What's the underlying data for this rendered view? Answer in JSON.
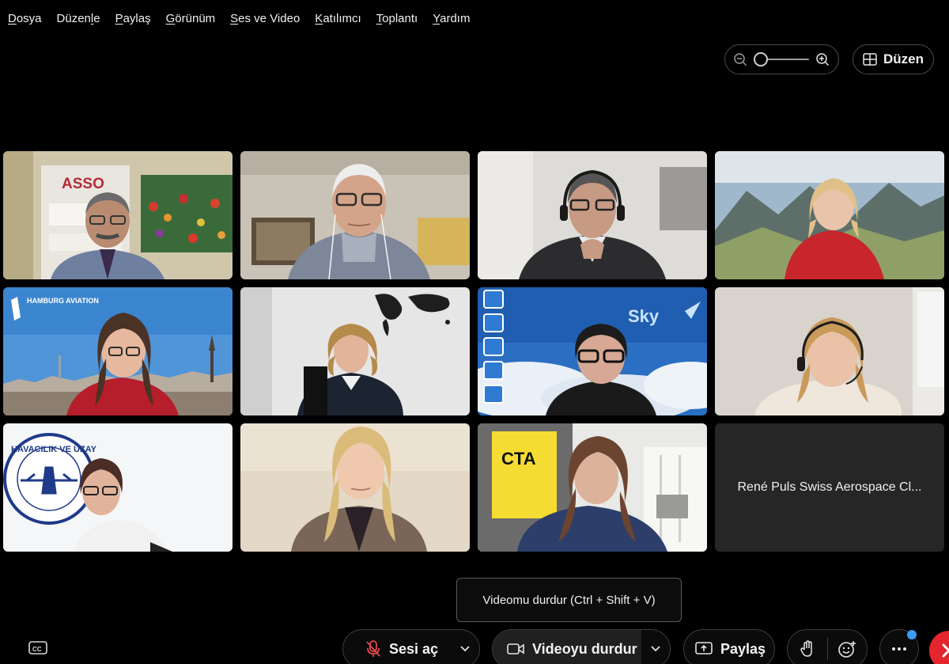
{
  "menu": [
    {
      "label": "Dosya",
      "shortcut_index": 0
    },
    {
      "label": "Düzenle",
      "shortcut_index": 5
    },
    {
      "label": "Paylaş",
      "shortcut_index": 0
    },
    {
      "label": "Görünüm",
      "shortcut_index": 0
    },
    {
      "label": "Ses ve Video",
      "shortcut_index": 0
    },
    {
      "label": "Katılımcı",
      "shortcut_index": 0
    },
    {
      "label": "Toplantı",
      "shortcut_index": 0
    },
    {
      "label": "Yardım",
      "shortcut_index": 0
    }
  ],
  "toolbar": {
    "zoom_level": 0,
    "layout_label": "Düzen"
  },
  "tiles": [
    {
      "kind": "video",
      "scene": "office-poster",
      "signage": "ASSO"
    },
    {
      "kind": "video",
      "scene": "elderly-man"
    },
    {
      "kind": "video",
      "scene": "man-headset"
    },
    {
      "kind": "video",
      "scene": "woman-mountains"
    },
    {
      "kind": "video",
      "scene": "hamburg-backdrop",
      "signage": "HAMBURG AVIATION"
    },
    {
      "kind": "video",
      "scene": "woman-map-wall"
    },
    {
      "kind": "video",
      "scene": "sky-backdrop",
      "signage": "Sky"
    },
    {
      "kind": "video",
      "scene": "woman-office"
    },
    {
      "kind": "video",
      "scene": "cluster-logo",
      "signage": "HAVACILIK VE UZAY"
    },
    {
      "kind": "video",
      "scene": "woman-blazer"
    },
    {
      "kind": "video",
      "scene": "cta-office",
      "signage": "CTA"
    },
    {
      "kind": "name",
      "name": "René Puls Swiss Aerospace Cl..."
    }
  ],
  "tooltip": "Videomu durdur (Ctrl + Shift + V)",
  "controls": {
    "mute_label": "Sesi aç",
    "video_label": "Videoyu durdur",
    "share_label": "Paylaş"
  },
  "icons": [
    "zoom-out-icon",
    "zoom-in-icon",
    "grid-layout-icon",
    "closed-caption-icon",
    "microphone-muted-icon",
    "camera-icon",
    "share-screen-icon",
    "raise-hand-icon",
    "reactions-icon",
    "more-icon",
    "end-call-icon"
  ],
  "colors": {
    "background": "#000000",
    "tile_name_bg": "#262626",
    "mute_icon": "#e5484d",
    "end_call": "#e5252e",
    "notification_dot": "#3b9cf5"
  }
}
